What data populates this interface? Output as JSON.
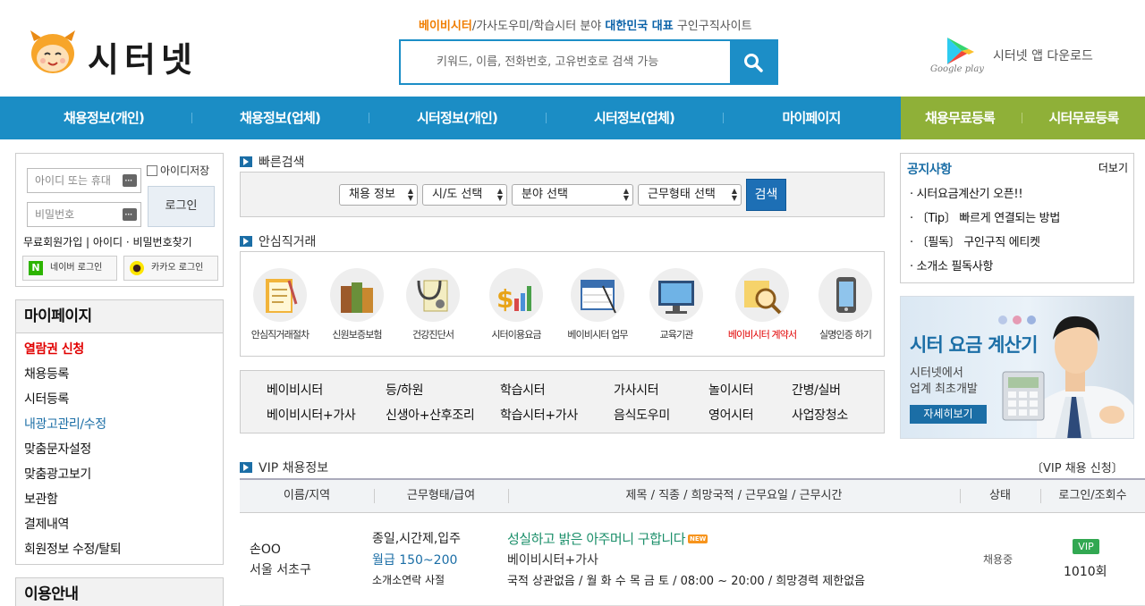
{
  "header": {
    "logo_text": "시터넷",
    "tagline": {
      "part1": "베이비시터",
      "part2": "/가사도우미/학습시터 분야 ",
      "part3": "대한민국 대표",
      "part4": " 구인구직사이트"
    },
    "search_placeholder": "키워드, 이름, 전화번호, 고유번호로 검색 가능",
    "google_play": "Google play",
    "app_download": "시터넷 앱 다운로드"
  },
  "nav": {
    "items": [
      "채용정보(개인)",
      "채용정보(업체)",
      "시터정보(개인)",
      "시터정보(업체)",
      "마이페이지"
    ],
    "green_items": [
      "채용무료등록",
      "시터무료등록"
    ]
  },
  "login": {
    "id_placeholder": "아이디 또는 휴대",
    "pw_placeholder": "비밀번호",
    "save_id": "아이디저장",
    "login_button": "로그인",
    "links": "무료회원가입 | 아이디 · 비밀번호찾기",
    "naver_login": "네이버 로그인",
    "kakao_login": "카카오 로그인"
  },
  "mypage": {
    "title": "마이페이지",
    "items": [
      "열람권 신청",
      "채용등록",
      "시터등록",
      "내광고관리/수정",
      "맞춤문자설정",
      "맞춤광고보기",
      "보관함",
      "결제내역",
      "회원정보 수정/탈퇴"
    ]
  },
  "guide": {
    "title": "이용안내"
  },
  "quick_search": {
    "title": "빠른검색",
    "selects": [
      "채용 정보",
      "시/도 선택",
      "분야 선택",
      "근무형태 선택"
    ],
    "button": "검색"
  },
  "safe_trade": {
    "title": "안심직거래",
    "items": [
      "안심직거래절차",
      "신원보증보험",
      "건강진단서",
      "시터이용요금",
      "베이비시터 업무",
      "교육기관",
      "베이비시터 계약서",
      "실명인증 하기"
    ]
  },
  "categories": {
    "row1": [
      "베이비시터",
      "등/하원",
      "학습시터",
      "가사시터",
      "놀이시터",
      "간병/실버"
    ],
    "row2": [
      "베이비시터+가사",
      "신생아+산후조리",
      "학습시터+가사",
      "음식도우미",
      "영어시터",
      "사업장청소"
    ]
  },
  "vip": {
    "title": "VIP 채용정보",
    "apply": "〔VIP 채용 신청〕",
    "columns": [
      "이름/지역",
      "근무형태/급여",
      "제목 / 직종 / 희망국적 / 근무요일 / 근무시간",
      "상태",
      "로그인/조회수"
    ],
    "rows": [
      {
        "name": "손OO",
        "region": "서울 서초구",
        "work_type": "종일,시간제,입주",
        "pay": "월급 150~200",
        "contact": "소개소연락 사절",
        "title": "성실하고 밝은 아주머니 구합니다",
        "new_badge": "NEW",
        "job": "베이비시터+가사",
        "details": "국적 상관없음 / 월 화 수 목 금 토 / 08:00 ~ 20:00 / 희망경력 제한없음",
        "status": "채용중",
        "vip_badge": "VIP",
        "views": "1010회"
      }
    ]
  },
  "notice": {
    "title": "공지사항",
    "more": "더보기",
    "items": [
      "· 시터요금계산기 오픈!!",
      "· 〔Tip〕 빠르게 연결되는 방법",
      "· 〔필독〕 구인구직 에티켓",
      "· 소개소 필독사항"
    ]
  },
  "banner": {
    "title": "시터 요금 계산기",
    "sub1": "시터넷에서",
    "sub2": "업계 최초개발",
    "button": "자세히보기"
  },
  "colors": {
    "nav_blue": "#1b8dc5",
    "nav_green": "#8fb038",
    "brand_orange": "#f07d00",
    "accent_red": "#e10000",
    "title_green": "#1b8f6a"
  }
}
